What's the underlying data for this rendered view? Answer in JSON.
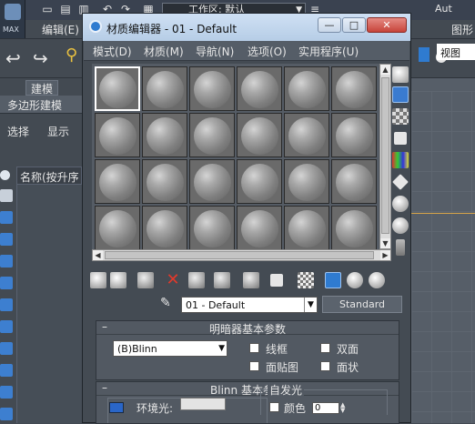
{
  "app": {
    "logo_text": "MAX",
    "workspace": "工作区: 默认",
    "vendor": "Aut",
    "menu": [
      "编辑(E)",
      "图形"
    ],
    "tabs": [
      "建模"
    ],
    "subobject_bar": "多边形建模",
    "side_tabs": [
      "选择",
      "显示"
    ],
    "scene_header": "名称(按升序",
    "viewport_title": "视图"
  },
  "material_editor": {
    "title": "材质编辑器 - 01 - Default",
    "window_buttons": [
      "—",
      "□",
      "✕"
    ],
    "menu": [
      "模式(D)",
      "材质(M)",
      "导航(N)",
      "选项(O)",
      "实用程序(U)"
    ],
    "slots": {
      "rows": 4,
      "cols": 6,
      "active_index": 0
    },
    "material_name": "01 - Default",
    "material_type": "Standard",
    "shader_rollout": {
      "title": "明暗器基本参数",
      "shader": "(B)Blinn",
      "options": [
        {
          "label": "线框",
          "checked": false
        },
        {
          "label": "双面",
          "checked": false
        },
        {
          "label": "面贴图",
          "checked": false
        },
        {
          "label": "面状",
          "checked": false
        }
      ]
    },
    "blinn_rollout": {
      "title": "Blinn 基本参数",
      "ambient_label": "环境光:",
      "self_illum_group": "自发光",
      "color_label": "颜色",
      "color_value": "0"
    }
  },
  "colors": {
    "ui_bg": "#434a52",
    "title_gradient": "#cfe0f4",
    "sample_slot_bg": "#6a6a6a",
    "ambient_swatch": "#2a66c8",
    "accent_highlight": "#2f7bd0"
  }
}
